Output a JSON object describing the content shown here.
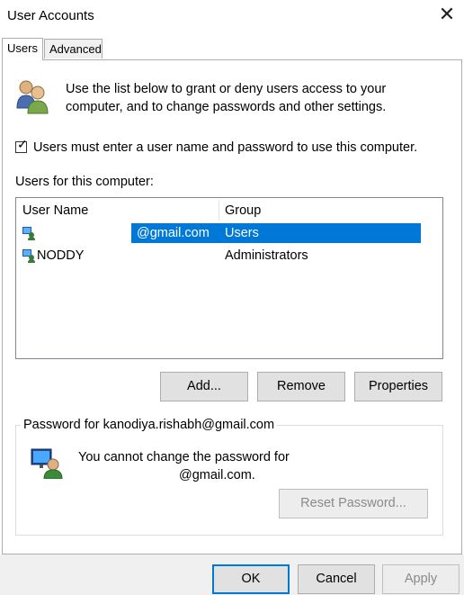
{
  "window": {
    "title": "User Accounts",
    "close_glyph": "✕"
  },
  "tabs": [
    {
      "label": "Users"
    },
    {
      "label": "Advanced"
    }
  ],
  "intro_text": "Use the list below to grant or deny users access to your computer, and to change passwords and other settings.",
  "must_login": {
    "label": "Users must enter a user name and password to use this computer.",
    "checked": true,
    "mark": "✓"
  },
  "users_label": "Users for this computer:",
  "list": {
    "columns": [
      "User Name",
      "Group"
    ],
    "rows": [
      {
        "name": "@gmail.com",
        "group": "Users",
        "selected": true
      },
      {
        "name": "NODDY",
        "group": "Administrators",
        "selected": false
      }
    ]
  },
  "list_buttons": {
    "add": "Add...",
    "remove": "Remove",
    "properties": "Properties"
  },
  "password_group": {
    "title": "Password for kanodiya.rishabh@gmail.com",
    "line1": "You cannot change the password for",
    "line2": "@gmail.com.",
    "reset_button": "Reset Password..."
  },
  "footer": {
    "ok": "OK",
    "cancel": "Cancel",
    "apply": "Apply"
  },
  "colors": {
    "selection": "#0078d7",
    "accent_border": "#0078d7"
  },
  "icons": {
    "users_header": "users-pair-icon",
    "user_row": "user-icon",
    "password": "user-password-icon"
  }
}
